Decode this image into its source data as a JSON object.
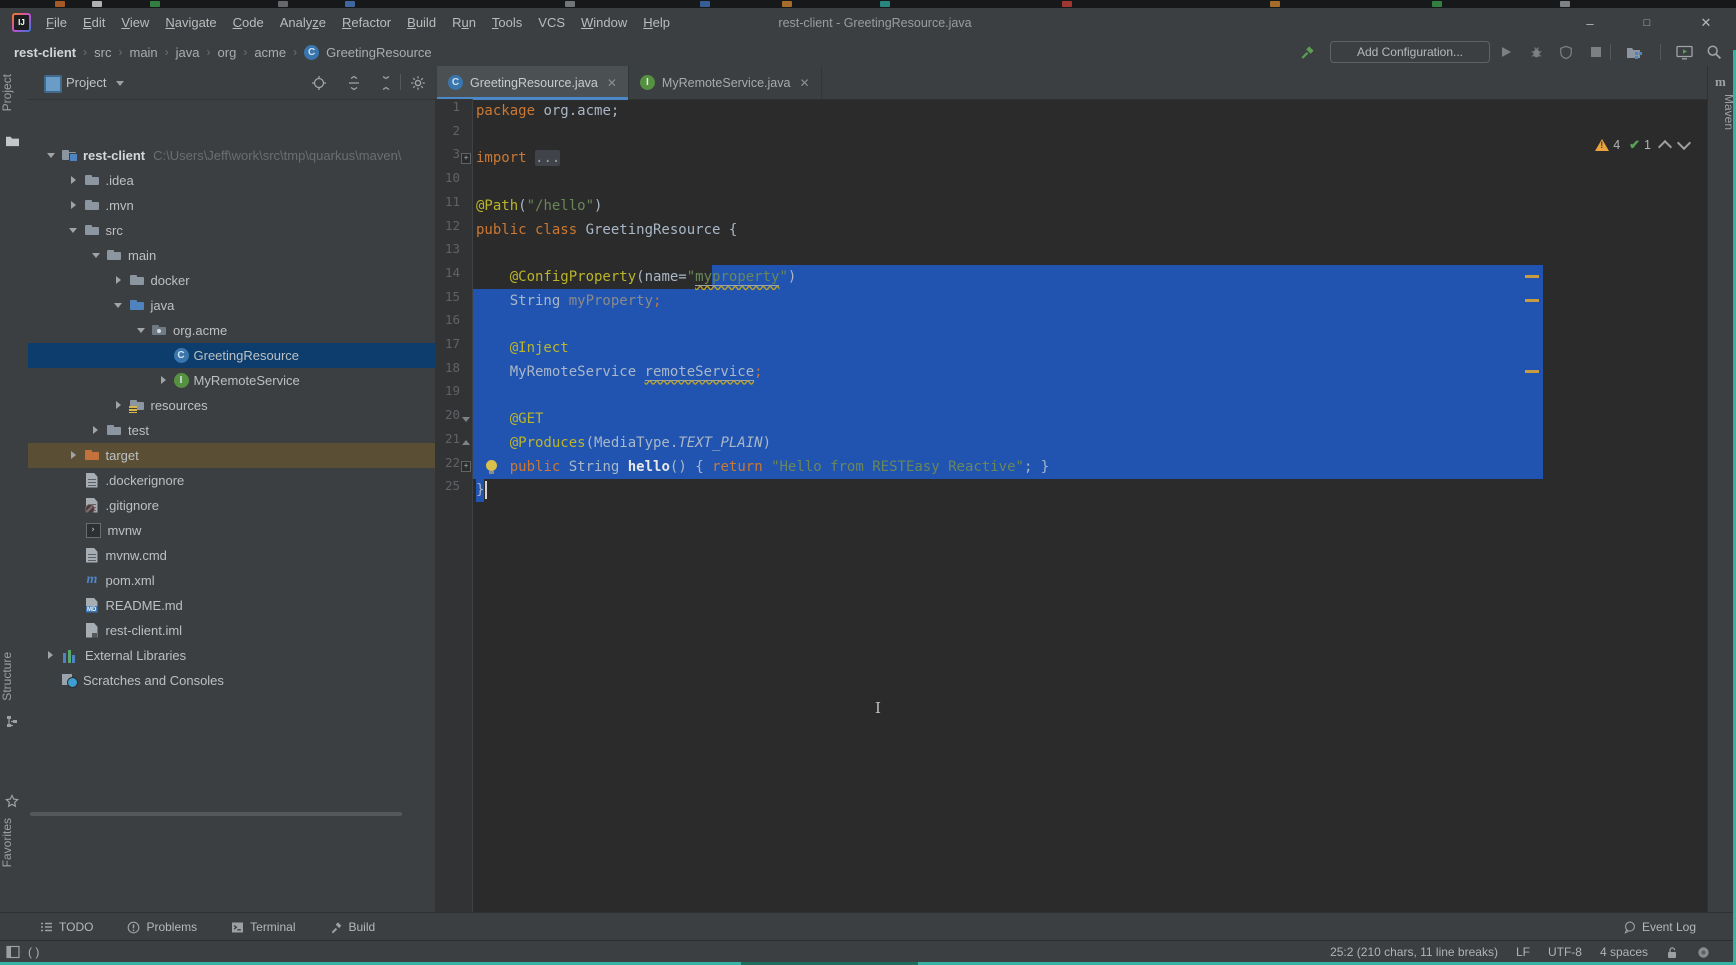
{
  "window": {
    "title": "rest-client - GreetingResource.java",
    "controls": {
      "minimize": "–",
      "maximize": "□",
      "close": "✕"
    }
  },
  "menu": {
    "items": [
      {
        "label": "File",
        "u": 0
      },
      {
        "label": "Edit",
        "u": 0
      },
      {
        "label": "View",
        "u": 0
      },
      {
        "label": "Navigate",
        "u": 0
      },
      {
        "label": "Code",
        "u": 0
      },
      {
        "label": "Analyze",
        "u": 5
      },
      {
        "label": "Refactor",
        "u": 0
      },
      {
        "label": "Build",
        "u": 0
      },
      {
        "label": "Run",
        "u": 1
      },
      {
        "label": "Tools",
        "u": 0
      },
      {
        "label": "VCS",
        "u": -1
      },
      {
        "label": "Window",
        "u": 0
      },
      {
        "label": "Help",
        "u": 0
      }
    ]
  },
  "breadcrumbs": {
    "items": [
      "rest-client",
      "src",
      "main",
      "java",
      "org",
      "acme",
      "GreetingResource"
    ]
  },
  "toolbar": {
    "add_configuration": "Add Configuration..."
  },
  "left_stripe": {
    "top": "Project",
    "bottom": [
      "Structure",
      "Favorites"
    ]
  },
  "right_stripe": {
    "label": "Maven",
    "logo": "m"
  },
  "project_panel": {
    "title": "Project",
    "tree": [
      {
        "label": "rest-client",
        "path": "C:\\Users\\Jeff\\work\\src\\tmp\\quarkus\\maven\\",
        "icon": "project",
        "arrow": "down",
        "indent": 0,
        "bold": true
      },
      {
        "label": ".idea",
        "icon": "folder",
        "arrow": "right",
        "indent": 1
      },
      {
        "label": ".mvn",
        "icon": "folder",
        "arrow": "right",
        "indent": 1
      },
      {
        "label": "src",
        "icon": "folder",
        "arrow": "down",
        "indent": 1
      },
      {
        "label": "main",
        "icon": "folder",
        "arrow": "down",
        "indent": 2
      },
      {
        "label": "docker",
        "icon": "folder",
        "arrow": "right",
        "indent": 3
      },
      {
        "label": "java",
        "icon": "folder-blue",
        "arrow": "down",
        "indent": 3
      },
      {
        "label": "org.acme",
        "icon": "package",
        "arrow": "down",
        "indent": 4
      },
      {
        "label": "GreetingResource",
        "icon": "class",
        "indent": 5,
        "selected": true
      },
      {
        "label": "MyRemoteService",
        "icon": "interface",
        "arrow": "right",
        "indent": 5
      },
      {
        "label": "resources",
        "icon": "folder-res",
        "arrow": "right",
        "indent": 3
      },
      {
        "label": "test",
        "icon": "folder",
        "arrow": "right",
        "indent": 2
      },
      {
        "label": "target",
        "icon": "folder-orange",
        "arrow": "right",
        "indent": 1,
        "excluded": true
      },
      {
        "label": ".dockerignore",
        "icon": "file",
        "indent": 1
      },
      {
        "label": ".gitignore",
        "icon": "file-ignored",
        "indent": 1
      },
      {
        "label": "mvnw",
        "icon": "console",
        "indent": 1
      },
      {
        "label": "mvnw.cmd",
        "icon": "file",
        "indent": 1
      },
      {
        "label": "pom.xml",
        "icon": "maven",
        "indent": 1
      },
      {
        "label": "README.md",
        "icon": "markdown",
        "indent": 1
      },
      {
        "label": "rest-client.iml",
        "icon": "iml",
        "indent": 1
      },
      {
        "label": "External Libraries",
        "icon": "libraries",
        "arrow": "right",
        "indent": 0
      },
      {
        "label": "Scratches and Consoles",
        "icon": "scratches",
        "indent": 0
      }
    ]
  },
  "tabs": [
    {
      "label": "GreetingResource.java",
      "icon": "class",
      "active": true
    },
    {
      "label": "MyRemoteService.java",
      "icon": "interface",
      "active": false
    }
  ],
  "editor": {
    "inspections": {
      "warnings": "4",
      "passed": "1"
    },
    "right_margin_marks": [
      "14",
      "15",
      "18"
    ],
    "lines": [
      {
        "n": "1",
        "t": [
          [
            "package",
            "kw"
          ],
          [
            " org.acme;",
            "pl"
          ]
        ]
      },
      {
        "n": "2",
        "t": []
      },
      {
        "n": "3",
        "fold": "plus",
        "t": [
          [
            "import ",
            "kw"
          ],
          [
            "...",
            "fold"
          ]
        ]
      },
      {
        "n": "10",
        "t": []
      },
      {
        "n": "11",
        "t": [
          [
            "@Path",
            "ann"
          ],
          [
            "(",
            "pl"
          ],
          [
            "\"/hello\"",
            "str"
          ],
          [
            ")",
            "pl"
          ]
        ]
      },
      {
        "n": "12",
        "t": [
          [
            "public class ",
            "kw"
          ],
          [
            "GreetingResource {",
            "pl"
          ]
        ]
      },
      {
        "n": "13",
        "t": []
      },
      {
        "n": "14",
        "sel": {
          "startCh": 28
        },
        "t": [
          [
            "    ",
            "pl"
          ],
          [
            "@ConfigProperty",
            "ann"
          ],
          [
            "(name=",
            "pl"
          ],
          [
            "\"",
            "str"
          ],
          [
            "myproperty",
            "str warn"
          ],
          [
            "\"",
            "str"
          ],
          [
            ")",
            "pl"
          ]
        ]
      },
      {
        "n": "15",
        "sel": {
          "edge": true
        },
        "t": [
          [
            "    String ",
            "pl"
          ],
          [
            "myProperty",
            "gray"
          ],
          [
            ";",
            "kw"
          ]
        ]
      },
      {
        "n": "16",
        "sel": {
          "edge": true
        },
        "t": []
      },
      {
        "n": "17",
        "sel": {
          "edge": true
        },
        "t": [
          [
            "    ",
            "pl"
          ],
          [
            "@Inject",
            "ann"
          ]
        ]
      },
      {
        "n": "18",
        "sel": {
          "edge": true
        },
        "t": [
          [
            "    MyRemoteService ",
            "pl"
          ],
          [
            "remoteService",
            "pl warn"
          ],
          [
            ";",
            "kw"
          ]
        ]
      },
      {
        "n": "19",
        "sel": {
          "edge": true
        },
        "t": []
      },
      {
        "n": "20",
        "fold": "open",
        "sel": {
          "edge": true
        },
        "t": [
          [
            "    ",
            "pl"
          ],
          [
            "@GET",
            "ann"
          ]
        ]
      },
      {
        "n": "21",
        "fold": "close",
        "sel": {
          "edge": true
        },
        "t": [
          [
            "    ",
            "pl"
          ],
          [
            "@Produces",
            "ann"
          ],
          [
            "(MediaType.",
            "pl"
          ],
          [
            "TEXT_PLAIN",
            "const"
          ],
          [
            ")",
            "pl"
          ]
        ]
      },
      {
        "n": "22",
        "fold": "plus",
        "bulb": true,
        "sel": {
          "edge": true
        },
        "t": [
          [
            "    ",
            "pl"
          ],
          [
            "public ",
            "kw"
          ],
          [
            "String ",
            "pl"
          ],
          [
            "hello",
            "decl"
          ],
          [
            "() { ",
            "pl"
          ],
          [
            "return ",
            "kw"
          ],
          [
            "\"Hello from RESTEasy Reactive\"",
            "str"
          ],
          [
            "; }",
            "pl"
          ]
        ]
      },
      {
        "n": "25",
        "caret": true,
        "sel": {
          "startCh": 0,
          "endCh": 1
        },
        "t": [
          [
            "}",
            "pl"
          ]
        ]
      }
    ]
  },
  "bottom_bar": {
    "items": [
      "TODO",
      "Problems",
      "Terminal",
      "Build"
    ],
    "right": "Event Log"
  },
  "status_bar": {
    "left": "( )",
    "position": "25:2 (210 chars, 11 line breaks)",
    "line_ending": "LF",
    "encoding": "UTF-8",
    "indent": "4 spaces"
  }
}
